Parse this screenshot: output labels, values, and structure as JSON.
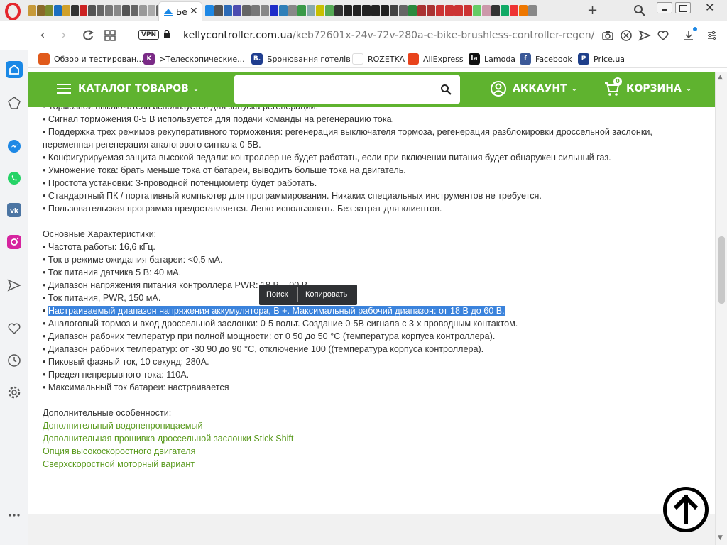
{
  "browser": {
    "active_tab": {
      "title": "Бе",
      "close": "✕"
    },
    "new_tab": "+",
    "address": {
      "vpn": "VPN",
      "url_host": "kellycontroller.com.ua",
      "url_path": "/keb72601x-24v-72v-280a-e-bike-brushless-controller-regen/"
    },
    "bookmarks": [
      {
        "label": "Обзор и тестирован...",
        "icon": "review-icon",
        "color": "#e05a1b",
        "glyph": ""
      },
      {
        "label": "⊳Телескопические...",
        "icon": "telescope-shop-icon",
        "color": "#7a2a86",
        "glyph": "K"
      },
      {
        "label": "Бронювання готелів",
        "icon": "booking-icon",
        "color": "#1f3d8f",
        "glyph": "B."
      },
      {
        "label": "ROZETKA",
        "icon": "rozetka-icon",
        "color": "#ffffff",
        "glyph": ""
      },
      {
        "label": "AliExpress",
        "icon": "aliexpress-icon",
        "color": "#e8431c",
        "glyph": ""
      },
      {
        "label": "Lamoda",
        "icon": "lamoda-icon",
        "color": "#111111",
        "glyph": "la"
      },
      {
        "label": "Facebook",
        "icon": "facebook-icon",
        "color": "#3b5998",
        "glyph": "f"
      },
      {
        "label": "Price.ua",
        "icon": "priceua-icon",
        "color": "#1e3f8a",
        "glyph": "P"
      }
    ],
    "bookmarks_more": "»"
  },
  "site": {
    "catalog_label": "КАТАЛОГ ТОВАРОВ",
    "search_placeholder": "",
    "account_label": "АККАУНТ",
    "cart_label": "КОРЗИНА",
    "cart_count": "0",
    "accent_color": "#5fb32f"
  },
  "content": {
    "lines": [
      "• Тормозной выключатель используется для запуска регенерации.",
      "• Сигнал торможения 0-5 В используется для подачи команды на регенерацию тока.",
      "• Поддержка трех режимов рекуперативного торможения: регенерация выключателя тормоза, регенерация разблокировки дроссельной заслонки, переменная регенерация аналогового сигнала 0-5В.",
      "• Конфигурируемая защита высокой педали: контроллер не будет работать, если при включении питания будет обнаружен сильный газ.",
      "• Умножение тока: брать меньше тока от батареи, выводить больше тока на двигатель.",
      "• Простота установки: 3-проводной потенциометр будет работать.",
      "• Стандартный ПК / портативный компьютер для программирования. Никаких специальных инструментов не требуется.",
      "• Пользовательская программа предоставляется. Легко использовать. Без затрат для клиентов."
    ],
    "specs_heading": "Основные Характеристики:",
    "specs": [
      "• Частота работы: 16,6 кГц.",
      "• Ток в режиме ожидания батареи: <0,5 мА.",
      "• Ток питания датчика 5 В: 40 мА.",
      "• Диапазон напряжения питания контроллера PWR: 18 В ~ 90 В.",
      "• Ток питания, PWR, 150 мА."
    ],
    "selected_bullet": "•",
    "selected_text": "Настраиваемый диапазон напряжения аккумулятора, В +. Максимальный рабочий диапазон: от 18 В до 60 В.",
    "specs2": [
      "• Аналоговый тормоз и вход дроссельной заслонки: 0-5 вольт. Создание 0-5В сигнала с 3-х проводным контактом.",
      "• Диапазон рабочих температур при полной мощности: от 0 50 до 50 °C (температура корпуса контроллера).",
      "• Диапазон рабочих температур: от -30 90 до 90 °C, отключение 100 ((температура корпуса контроллера).",
      "• Пиковый фазный ток, 10 секунд: 280А.",
      "• Предел непрерывного тока: 110А.",
      "• Максимальный ток батареи: настраивается"
    ],
    "extra_heading": "Дополнительные особенности:",
    "extra_links": [
      "Дополнительный водонепроницаемый",
      "Дополнительная прошивка дроссельной заслонки Stick Shift",
      "Опция высокоскоростного двигателя",
      "Сверхскоростной моторный вариант"
    ],
    "context_menu": {
      "search": "Поиск",
      "copy": "Копировать"
    }
  }
}
